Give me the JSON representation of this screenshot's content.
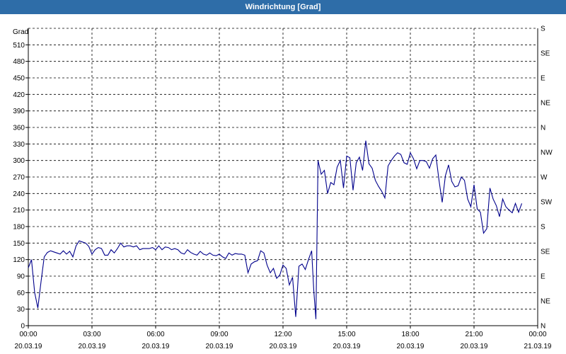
{
  "title": "Windrichtung [Grad]",
  "colors": {
    "titlebar": "#2e6da8",
    "line": "#00008b",
    "grid": "#000000"
  },
  "chart_data": {
    "type": "line",
    "title": "Windrichtung [Grad]",
    "ylabel": "Grad",
    "ylim": [
      0,
      540
    ],
    "yticks": [
      0,
      30,
      60,
      90,
      120,
      150,
      180,
      210,
      240,
      270,
      300,
      330,
      360,
      390,
      420,
      450,
      480,
      510
    ],
    "right_ticks": [
      "N",
      "NE",
      "E",
      "SE",
      "S",
      "SW",
      "W",
      "NW",
      "N",
      "NE",
      "E",
      "SE",
      "S"
    ],
    "grid": true,
    "x_ticks": [
      {
        "time": "00:00",
        "date": "20.03.19"
      },
      {
        "time": "03:00",
        "date": "20.03.19"
      },
      {
        "time": "06:00",
        "date": "20.03.19"
      },
      {
        "time": "09:00",
        "date": "20.03.19"
      },
      {
        "time": "12:00",
        "date": "20.03.19"
      },
      {
        "time": "15:00",
        "date": "20.03.19"
      },
      {
        "time": "18:00",
        "date": "20.03.19"
      },
      {
        "time": "21:00",
        "date": "20.03.19"
      },
      {
        "time": "00:00",
        "date": "21.03.19"
      }
    ],
    "x_hours": [
      0,
      0.15,
      0.3,
      0.45,
      0.6,
      0.75,
      0.9,
      1.05,
      1.2,
      1.35,
      1.5,
      1.65,
      1.8,
      1.95,
      2.1,
      2.25,
      2.4,
      2.55,
      2.7,
      2.85,
      3,
      3.15,
      3.3,
      3.45,
      3.6,
      3.75,
      3.9,
      4.05,
      4.2,
      4.35,
      4.5,
      4.65,
      4.8,
      4.95,
      5.1,
      5.25,
      5.4,
      5.55,
      5.7,
      5.85,
      6,
      6.15,
      6.3,
      6.45,
      6.6,
      6.75,
      6.9,
      7.05,
      7.2,
      7.35,
      7.5,
      7.65,
      7.8,
      7.95,
      8.1,
      8.25,
      8.4,
      8.55,
      8.7,
      8.85,
      9,
      9.15,
      9.3,
      9.45,
      9.6,
      9.75,
      9.9,
      10.05,
      10.2,
      10.35,
      10.5,
      10.65,
      10.8,
      10.95,
      11.1,
      11.25,
      11.4,
      11.55,
      11.7,
      11.85,
      12,
      12.15,
      12.3,
      12.45,
      12.6,
      12.75,
      12.9,
      13.05,
      13.2,
      13.35,
      13.45,
      13.55,
      13.65,
      13.8,
      13.95,
      14.1,
      14.25,
      14.4,
      14.55,
      14.7,
      14.85,
      15,
      15.15,
      15.3,
      15.45,
      15.6,
      15.75,
      15.9,
      16.05,
      16.2,
      16.35,
      16.5,
      16.65,
      16.8,
      16.95,
      17.1,
      17.25,
      17.4,
      17.55,
      17.7,
      17.85,
      18,
      18.15,
      18.3,
      18.45,
      18.6,
      18.75,
      18.9,
      19.05,
      19.2,
      19.35,
      19.5,
      19.65,
      19.8,
      19.95,
      20.1,
      20.25,
      20.4,
      20.55,
      20.7,
      20.85,
      21,
      21.15,
      21.3,
      21.45,
      21.6,
      21.75,
      21.9,
      22.05,
      22.2,
      22.35,
      22.5,
      22.65,
      22.8,
      22.95,
      23.1,
      23.25,
      23.4,
      23.55,
      23.7,
      23.85,
      24
    ],
    "values": [
      105,
      120,
      60,
      32,
      80,
      125,
      133,
      136,
      134,
      132,
      130,
      136,
      130,
      135,
      125,
      145,
      154,
      152,
      150,
      144,
      130,
      138,
      142,
      140,
      128,
      128,
      138,
      132,
      140,
      150,
      143,
      145,
      145,
      143,
      145,
      138,
      140,
      140,
      140,
      142,
      138,
      145,
      138,
      143,
      142,
      138,
      140,
      138,
      132,
      130,
      138,
      133,
      130,
      128,
      135,
      130,
      128,
      132,
      128,
      127,
      130,
      125,
      122,
      132,
      128,
      131,
      130,
      130,
      128,
      96,
      112,
      116,
      118,
      136,
      132,
      110,
      96,
      104,
      86,
      92,
      110,
      104,
      74,
      88,
      16,
      108,
      112,
      102,
      120,
      136,
      64,
      12,
      300,
      275,
      282,
      240,
      260,
      256,
      288,
      300,
      250,
      308,
      305,
      246,
      296,
      306,
      282,
      336,
      294,
      286,
      264,
      253,
      244,
      232,
      290,
      300,
      308,
      314,
      311,
      296,
      293,
      314,
      303,
      285,
      300,
      300,
      298,
      286,
      303,
      310,
      264,
      224,
      272,
      292,
      262,
      252,
      254,
      270,
      264,
      230,
      216,
      256,
      212,
      206,
      168,
      176,
      250,
      230,
      218,
      198,
      230,
      216,
      210,
      205,
      222,
      206,
      222
    ]
  }
}
